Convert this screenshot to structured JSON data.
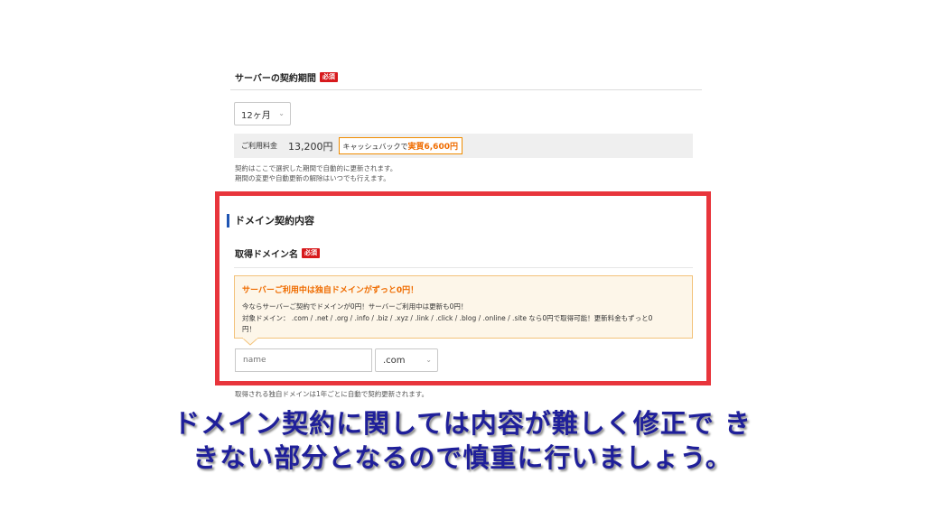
{
  "contract_period": {
    "title": "サーバーの契約期間",
    "required_badge": "必須",
    "select_value": "12ヶ月",
    "price_label": "ご利用料金",
    "price_value": "13,200円",
    "cashback_prefix": "キャッシュバックで",
    "cashback_value": "実質6,600円",
    "note_line1": "契約はここで選択した期間で自動的に更新されます。",
    "note_line2": "期間の変更や自動更新の解除はいつでも行えます。"
  },
  "domain_section": {
    "heading": "ドメイン契約内容",
    "field_label": "取得ドメイン名",
    "required_badge": "必須",
    "info_title": "サーバーご利用中は独自ドメインがずっと0円！",
    "info_line1": "今ならサーバーご契約でドメインが0円！サーバーご利用中は更新も0円！",
    "info_line2": "対象ドメイン： .com / .net / .org / .info / .biz / .xyz / .link / .click / .blog / .online / .site なら0円で取得可能！更新料金もずっと0",
    "info_line3": "円！",
    "name_placeholder": "name",
    "tld_value": ".com",
    "footnote": "取得される独自ドメインは1年ごとに自動で契約更新されます。"
  },
  "caption": {
    "line1": "ドメイン契約に関しては内容が難しく修正で き",
    "line2": "きない部分となるので慎重に行いましょう。"
  },
  "colors": {
    "highlight_frame": "#e8353c",
    "badge_red": "#d7191c",
    "accent_orange": "#ef6c00",
    "heading_bar_blue": "#1f55b3",
    "caption_text": "#1f1f9a"
  }
}
